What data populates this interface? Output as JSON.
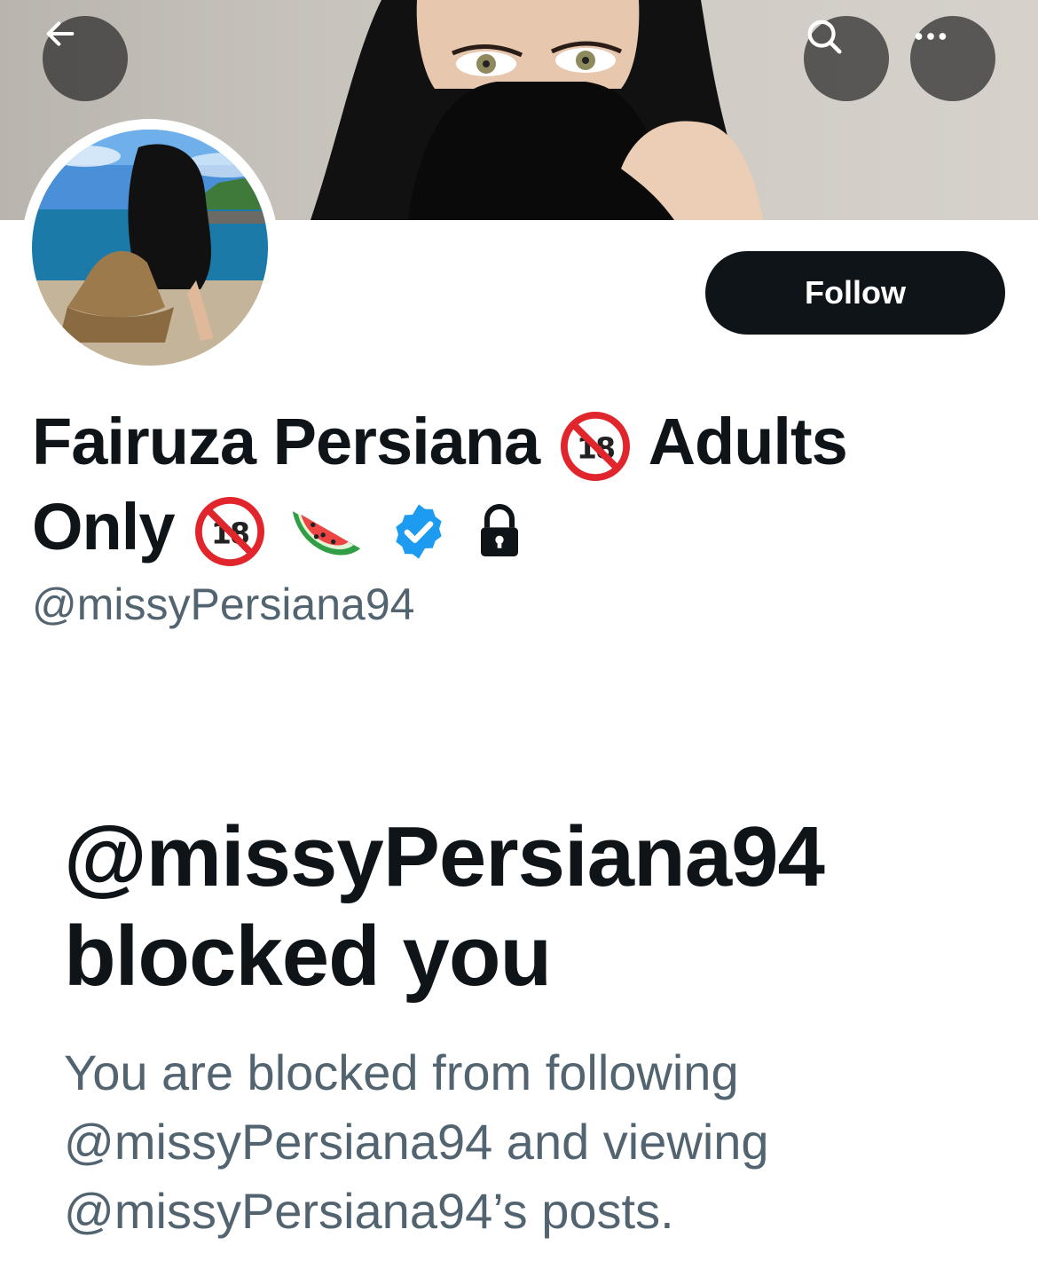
{
  "header": {
    "back_icon": "arrow-left-icon",
    "search_icon": "search-icon",
    "more_icon": "more-horizontal-icon"
  },
  "profile": {
    "follow_label": "Follow",
    "name_part1": "Fairuza Persiana",
    "name_part2": "Adults",
    "name_part3": "Only",
    "name_emojis": [
      "no-one-under-18-icon",
      "watermelon-icon",
      "verified-badge-icon",
      "lock-icon"
    ],
    "handle": "@missyPersiana94",
    "verified_color": "#1d9bf0"
  },
  "blocked": {
    "title": "@missyPersiana94 blocked you",
    "description": "You are blocked from following @missyPersiana94 and viewing @missyPersiana94’s posts."
  }
}
